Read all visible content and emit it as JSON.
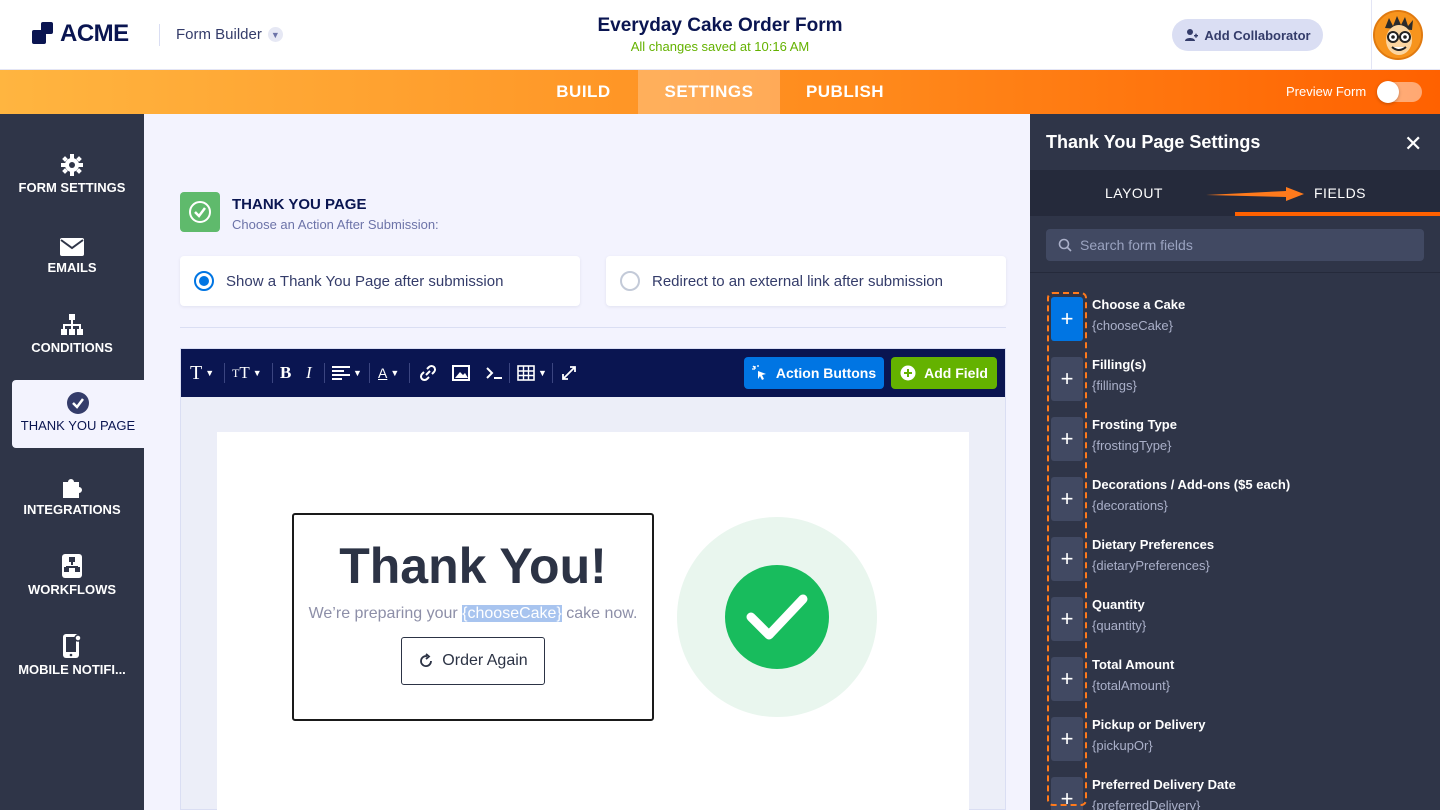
{
  "header": {
    "logo_text": "ACME",
    "builder_label": "Form Builder",
    "form_title": "Everyday Cake Order Form",
    "saved_status": "All changes saved at 10:16 AM",
    "collaborator_label": "Add Collaborator"
  },
  "nav": {
    "tabs": [
      {
        "label": "BUILD"
      },
      {
        "label": "SETTINGS"
      },
      {
        "label": "PUBLISH"
      }
    ],
    "active_tab": "SETTINGS",
    "preview_label": "Preview Form",
    "preview_on": false
  },
  "sidebar": {
    "items": [
      {
        "label": "FORM SETTINGS",
        "icon": "gear-icon"
      },
      {
        "label": "EMAILS",
        "icon": "envelope-icon"
      },
      {
        "label": "CONDITIONS",
        "icon": "sitemap-icon"
      },
      {
        "label": "THANK YOU PAGE",
        "icon": "check-circle-icon"
      },
      {
        "label": "INTEGRATIONS",
        "icon": "puzzle-icon"
      },
      {
        "label": "WORKFLOWS",
        "icon": "workflow-icon"
      },
      {
        "label": "MOBILE NOTIFI...",
        "icon": "mobile-icon"
      }
    ],
    "active_item": "THANK YOU PAGE"
  },
  "main": {
    "section_title": "THANK YOU PAGE",
    "section_subtitle": "Choose an Action After Submission:",
    "options": [
      {
        "label": "Show a Thank You Page after submission",
        "selected": true
      },
      {
        "label": "Redirect to an external link after submission",
        "selected": false
      }
    ],
    "toolbar": {
      "action_buttons_label": "Action Buttons",
      "add_field_label": "Add Field"
    },
    "preview": {
      "heading": "Thank You!",
      "message_before": "We’re preparing your ",
      "message_token": "{chooseCake}",
      "message_after": " cake now.",
      "button_label": "Order Again"
    }
  },
  "right_panel": {
    "title": "Thank You Page Settings",
    "tabs": [
      {
        "label": "LAYOUT"
      },
      {
        "label": "FIELDS"
      }
    ],
    "active_tab": "FIELDS",
    "search_placeholder": "Search form fields",
    "fields": [
      {
        "label": "Choose a Cake",
        "key": "{chooseCake}"
      },
      {
        "label": "Filling(s)",
        "key": "{fillings}"
      },
      {
        "label": "Frosting Type",
        "key": "{frostingType}"
      },
      {
        "label": "Decorations / Add-ons ($5 each)",
        "key": "{decorations}"
      },
      {
        "label": "Dietary Preferences",
        "key": "{dietaryPreferences}"
      },
      {
        "label": "Quantity",
        "key": "{quantity}"
      },
      {
        "label": "Total Amount",
        "key": "{totalAmount}"
      },
      {
        "label": "Pickup or Delivery",
        "key": "{pickupOr}"
      },
      {
        "label": "Preferred Delivery Date",
        "key": "{preferredDelivery}"
      }
    ]
  },
  "colors": {
    "navy": "#0a1551",
    "orange": "#ff6100",
    "blue": "#0075e3",
    "green": "#64b200",
    "success": "#18bc5d",
    "panel": "#2f3548"
  }
}
